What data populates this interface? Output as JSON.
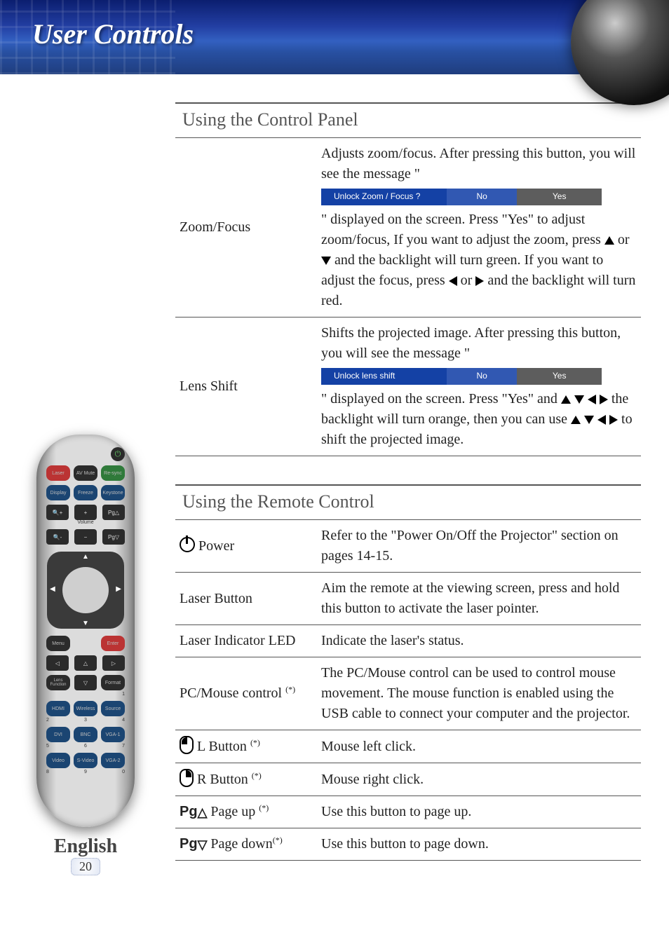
{
  "banner": {
    "title": "User Controls"
  },
  "prompt_zoom": {
    "question": "Unlock Zoom / Focus ?",
    "no": "No",
    "yes": "Yes"
  },
  "prompt_lens": {
    "question": "Unlock lens shift",
    "no": "No",
    "yes": "Yes"
  },
  "panel": {
    "heading": "Using the Control Panel",
    "rows": {
      "zoom": {
        "label": "Zoom/Focus",
        "t1": "Adjusts zoom/focus. After pressing this button, you will see the message \"",
        "t2": "\" displayed on the screen. Press \"Yes\" to adjust zoom/focus, If you want to adjust the zoom, press ",
        "t3": " or ",
        "t4": " and the backlight will turn green. If you want to adjust the focus, press ",
        "t5": " or ",
        "t6": " and the backlight will turn red."
      },
      "lens": {
        "label": "Lens Shift",
        "t1": "Shifts the projected image. After pressing this button, you will see the message \"",
        "t2": "\" displayed on the screen. Press \"Yes\" and ",
        "t3": " the backlight will turn orange, then you can use ",
        "t4": " to shift the projected image."
      }
    }
  },
  "remote_section": {
    "heading": "Using the Remote Control",
    "rows": {
      "power": {
        "label": " Power",
        "desc": "Refer to the \"Power On/Off the Projector\" section on pages 14-15."
      },
      "laser": {
        "label": "Laser Button",
        "desc": "Aim the remote at the viewing screen, press and hold this button to activate the laser pointer."
      },
      "laserled": {
        "label": "Laser Indicator LED",
        "desc": "Indicate the laser's status."
      },
      "pcmouse": {
        "label": "PC/Mouse control ",
        "desc": "The PC/Mouse control can be used to control mouse movement. The mouse function is enabled using the USB cable to connect your computer and the projector."
      },
      "lbtn": {
        "label": " L Button ",
        "desc": "Mouse left click."
      },
      "rbtn": {
        "label": " R Button ",
        "desc": "Mouse right click."
      },
      "pgup": {
        "label": " Page up ",
        "desc": "Use this button to page up."
      },
      "pgdn": {
        "label1": " Page",
        "label2": "down",
        "desc": "Use this button to page down."
      }
    },
    "footnote_marker": "(*)"
  },
  "remote_buttons": {
    "laser": "Laser",
    "avmute": "AV Mute",
    "resync": "Re-sync",
    "display": "Display",
    "freeze": "Freeze",
    "keystone": "Keystone",
    "zoomin": "🔍+",
    "plus": "+",
    "pgup": "Pg△",
    "zoomout": "🔍-",
    "minus": "−",
    "pgdn": "Pg▽",
    "volume": "Volume",
    "menu": "Menu",
    "enter": "Enter",
    "lens": "Lens Function",
    "format": "Format",
    "hdmi": "HDMI",
    "wireless": "Wireless",
    "source": "Source",
    "dvi": "DVI",
    "bnc": "BNC",
    "vga1": "VGA-1",
    "video": "Video",
    "svideo": "S-Video",
    "vga2": "VGA-2",
    "n1": "1",
    "n2": "2",
    "n3": "3",
    "n4": "4",
    "n5": "5",
    "n6": "6",
    "n7": "7",
    "n8": "8",
    "n9": "9",
    "n0": "0"
  },
  "footer": {
    "language": "English",
    "page": "20"
  }
}
